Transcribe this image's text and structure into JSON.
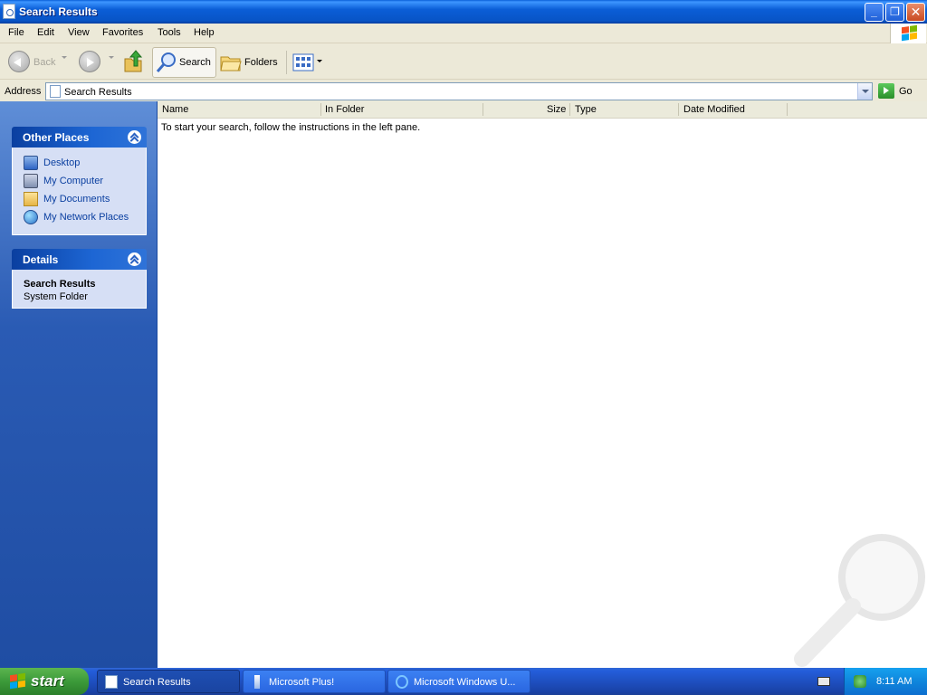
{
  "window": {
    "title": "Search Results",
    "controls": {
      "minimize": "_",
      "maximize": "❐",
      "close": "✕"
    }
  },
  "menu": [
    "File",
    "Edit",
    "View",
    "Favorites",
    "Tools",
    "Help"
  ],
  "toolbar": {
    "back_label": "Back",
    "search_label": "Search",
    "folders_label": "Folders"
  },
  "address": {
    "label": "Address",
    "value": "Search Results",
    "go_label": "Go"
  },
  "other_places": {
    "title": "Other Places",
    "items": [
      {
        "label": "Desktop",
        "icon": "desktop-icon"
      },
      {
        "label": "My Computer",
        "icon": "my-computer-icon"
      },
      {
        "label": "My Documents",
        "icon": "my-documents-icon"
      },
      {
        "label": "My Network Places",
        "icon": "my-network-places-icon"
      }
    ]
  },
  "details": {
    "title": "Details",
    "name": "Search Results",
    "type": "System Folder"
  },
  "list": {
    "columns": [
      "Name",
      "In Folder",
      "Size",
      "Type",
      "Date Modified"
    ],
    "empty_message": "To start your search, follow the instructions in the left pane."
  },
  "taskbar": {
    "start_label": "start",
    "items": [
      {
        "label": "Search Results",
        "active": true
      },
      {
        "label": "Microsoft Plus!",
        "active": false
      },
      {
        "label": "Microsoft Windows U...",
        "active": false
      }
    ],
    "clock": "8:11 AM"
  },
  "colors": {
    "title_bar": "#0b5ed7",
    "left_pane": "#2a5bb4",
    "panel_body": "#d6dff5",
    "link_text": "#0a3fa0",
    "start_button": "#3c9a3a",
    "taskbar": "#245edb"
  }
}
